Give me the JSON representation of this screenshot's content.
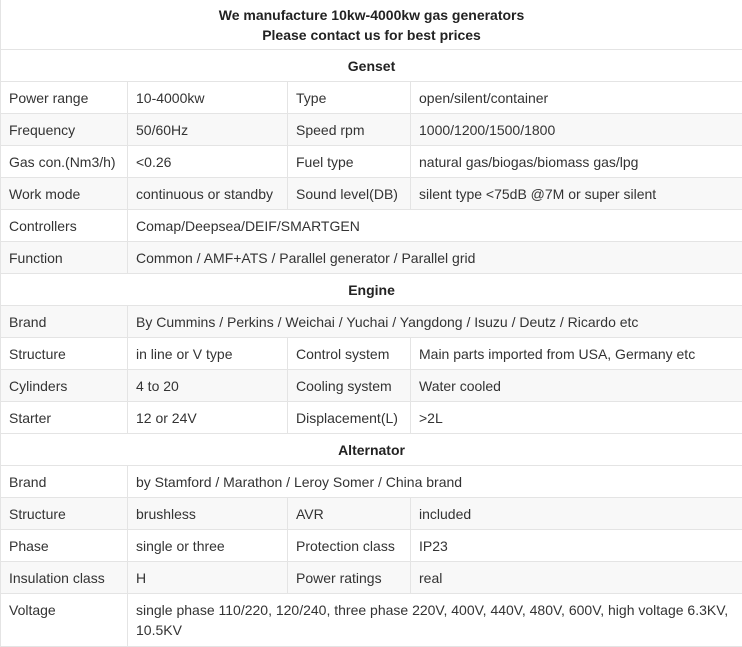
{
  "header": {
    "line1": "We manufacture 10kw-4000kw gas generators",
    "line2": "Please contact us for best prices"
  },
  "genset": {
    "title": "Genset",
    "power_range_label": "Power range",
    "power_range_value": "10-4000kw",
    "type_label": "Type",
    "type_value": "open/silent/container",
    "frequency_label": "Frequency",
    "frequency_value": "50/60Hz",
    "speed_label": "Speed rpm",
    "speed_value": "1000/1200/1500/1800",
    "gas_con_label": "Gas con.(Nm3/h)",
    "gas_con_value": "<0.26",
    "fuel_type_label": "Fuel type",
    "fuel_type_value": "natural gas/biogas/biomass gas/lpg",
    "work_mode_label": "Work mode",
    "work_mode_value": "continuous or standby",
    "sound_level_label": "Sound level(DB)",
    "sound_level_value": "silent type <75dB @7M or super silent",
    "controllers_label": "Controllers",
    "controllers_value": "Comap/Deepsea/DEIF/SMARTGEN",
    "function_label": "Function",
    "function_value": "Common / AMF+ATS / Parallel generator / Parallel grid"
  },
  "engine": {
    "title": "Engine",
    "brand_label": "Brand",
    "brand_value": "By Cummins / Perkins / Weichai / Yuchai / Yangdong / Isuzu / Deutz / Ricardo etc",
    "structure_label": "Structure",
    "structure_value": "in line or V type",
    "control_system_label": "Control system",
    "control_system_value": "Main parts imported from USA, Germany etc",
    "cylinders_label": "Cylinders",
    "cylinders_value": "4 to 20",
    "cooling_system_label": "Cooling system",
    "cooling_system_value": "Water cooled",
    "starter_label": "Starter",
    "starter_value": "12 or 24V",
    "displacement_label": "Displacement(L)",
    "displacement_value": ">2L"
  },
  "alternator": {
    "title": "Alternator",
    "brand_label": "Brand",
    "brand_value": "by Stamford / Marathon / Leroy Somer / China brand",
    "structure_label": "Structure",
    "structure_value": "brushless",
    "avr_label": "AVR",
    "avr_value": "included",
    "phase_label": "Phase",
    "phase_value": "single or three",
    "protection_label": "Protection class",
    "protection_value": "IP23",
    "insulation_label": "Insulation class",
    "insulation_value": "H",
    "power_ratings_label": "Power ratings",
    "power_ratings_value": "real",
    "voltage_label": "Voltage",
    "voltage_value_line1": "single phase 110/220, 120/240, three phase 220V, 400V, 440V, 480V, 600V, high voltage 6.3KV,",
    "voltage_value_line2": "10.5KV"
  }
}
